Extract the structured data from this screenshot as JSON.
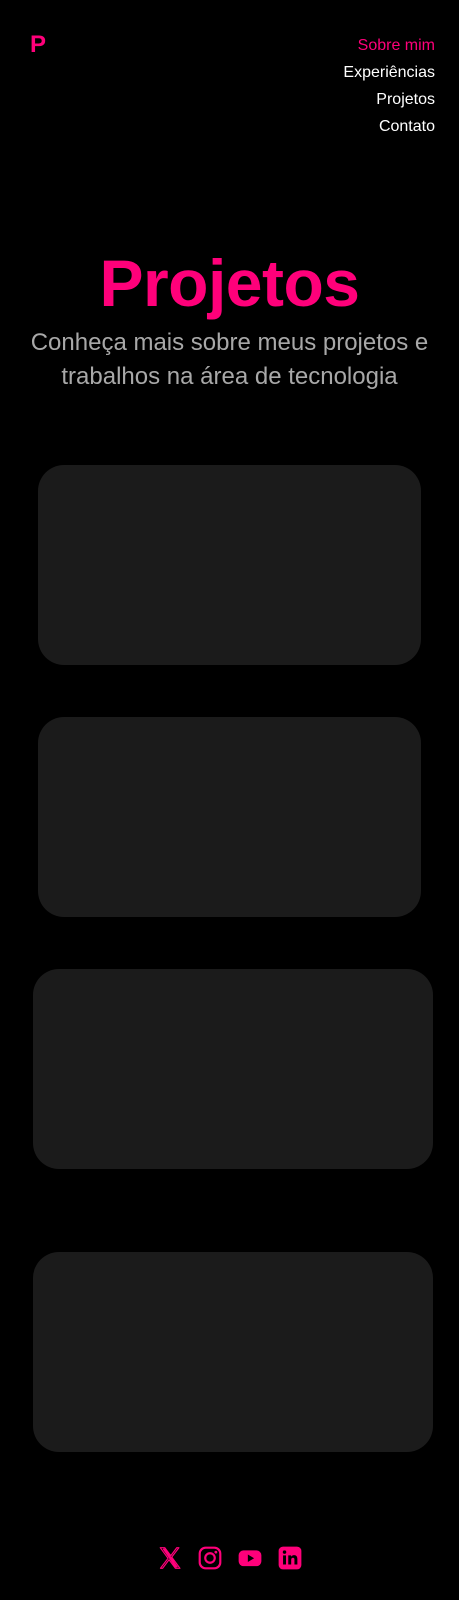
{
  "brand": {
    "logo": "P",
    "accent_color": "#ff007a",
    "background_color": "#000000",
    "card_color": "#1b1b1b",
    "muted_text_color": "#a8a8a8"
  },
  "nav": {
    "items": [
      {
        "label": "Sobre mim",
        "active": true
      },
      {
        "label": "Experiências",
        "active": false
      },
      {
        "label": "Projetos",
        "active": false
      },
      {
        "label": "Contato",
        "active": false
      }
    ]
  },
  "hero": {
    "title": "Projetos",
    "subtitle": "Conheça mais sobre meus projetos e trabalhos na área de tecnologia"
  },
  "projects": {
    "cards": [
      {
        "title": ""
      },
      {
        "title": ""
      },
      {
        "title": ""
      },
      {
        "title": ""
      }
    ]
  },
  "footer": {
    "socials": [
      {
        "icon": "x-twitter-icon"
      },
      {
        "icon": "instagram-icon"
      },
      {
        "icon": "youtube-icon"
      },
      {
        "icon": "linkedin-icon"
      }
    ]
  }
}
